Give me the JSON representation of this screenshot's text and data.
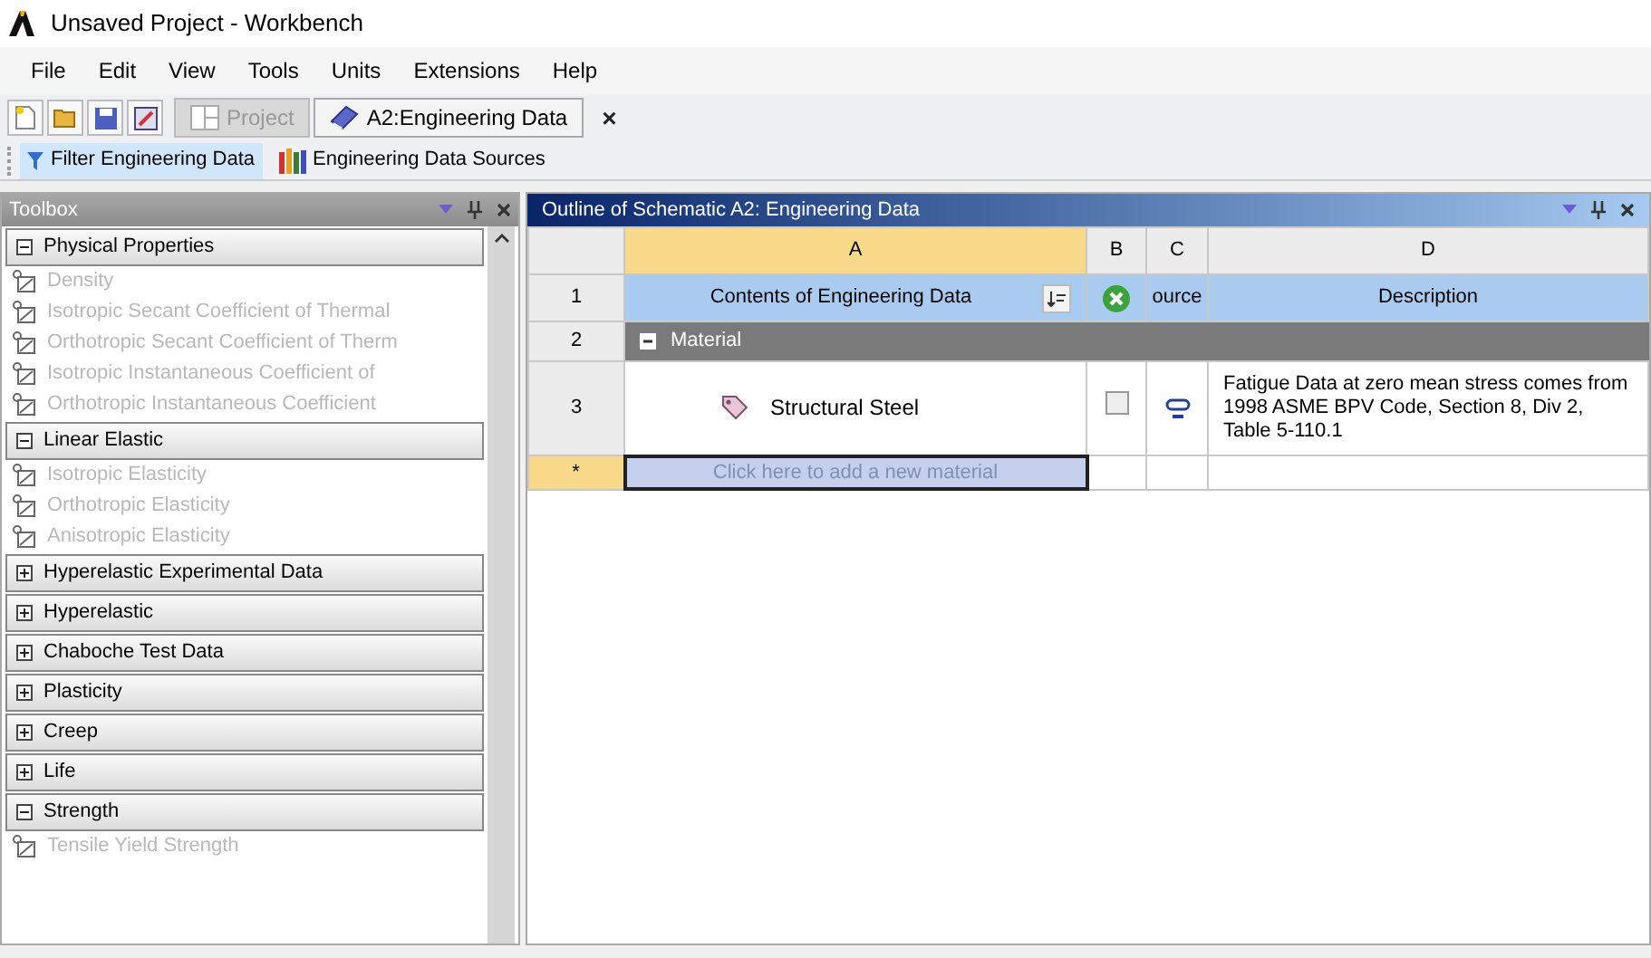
{
  "window": {
    "title": "Unsaved Project - Workbench"
  },
  "menu": [
    "File",
    "Edit",
    "View",
    "Tools",
    "Units",
    "Extensions",
    "Help"
  ],
  "tabs": [
    {
      "label": "Project",
      "selected": false
    },
    {
      "label": "A2:Engineering Data",
      "selected": true,
      "close": "×"
    }
  ],
  "view_buttons": [
    {
      "label": "Filter Engineering Data",
      "selected": true
    },
    {
      "label": "Engineering Data Sources",
      "selected": false
    }
  ],
  "toolbox": {
    "title": "Toolbox",
    "groups": [
      {
        "label": "Physical Properties",
        "expanded": true,
        "items": [
          {
            "label": "Density",
            "disabled": true
          },
          {
            "label": "Isotropic Secant Coefficient of Thermal",
            "disabled": true
          },
          {
            "label": "Orthotropic Secant Coefficient of Therm",
            "disabled": true
          },
          {
            "label": "Isotropic Instantaneous Coefficient of",
            "disabled": true
          },
          {
            "label": "Orthotropic Instantaneous Coefficient",
            "disabled": true
          }
        ]
      },
      {
        "label": "Linear Elastic",
        "expanded": true,
        "items": [
          {
            "label": "Isotropic Elasticity",
            "disabled": true
          },
          {
            "label": "Orthotropic Elasticity",
            "disabled": true
          },
          {
            "label": "Anisotropic Elasticity",
            "disabled": true
          }
        ]
      },
      {
        "label": "Hyperelastic Experimental Data",
        "expanded": false
      },
      {
        "label": "Hyperelastic",
        "expanded": false
      },
      {
        "label": "Chaboche Test Data",
        "expanded": false
      },
      {
        "label": "Plasticity",
        "expanded": false
      },
      {
        "label": "Creep",
        "expanded": false
      },
      {
        "label": "Life",
        "expanded": false
      },
      {
        "label": "Strength",
        "expanded": true,
        "items": [
          {
            "label": "Tensile Yield Strength",
            "disabled": true
          }
        ]
      }
    ]
  },
  "outline": {
    "title": "Outline of Schematic A2: Engineering Data",
    "columns": [
      {
        "label": "A",
        "selected": true
      },
      {
        "label": "B",
        "selected": false
      },
      {
        "label": "C",
        "selected": false
      },
      {
        "label": "D",
        "selected": false
      }
    ],
    "rows": [
      {
        "kind": "header",
        "number": "1",
        "contents": "Contents of Engineering Data",
        "source": "ource",
        "description": "Description"
      },
      {
        "kind": "group",
        "number": "2",
        "label": "Material",
        "expanded": true
      },
      {
        "kind": "material",
        "number": "3",
        "name": "Structural Steel",
        "checked": false,
        "description": "Fatigue Data at zero mean stress comes from 1998 ASME BPV Code, Section 8, Div 2, Table 5-110.1"
      },
      {
        "kind": "new",
        "number": "*",
        "placeholder": "Click here to add a new material"
      }
    ]
  }
}
